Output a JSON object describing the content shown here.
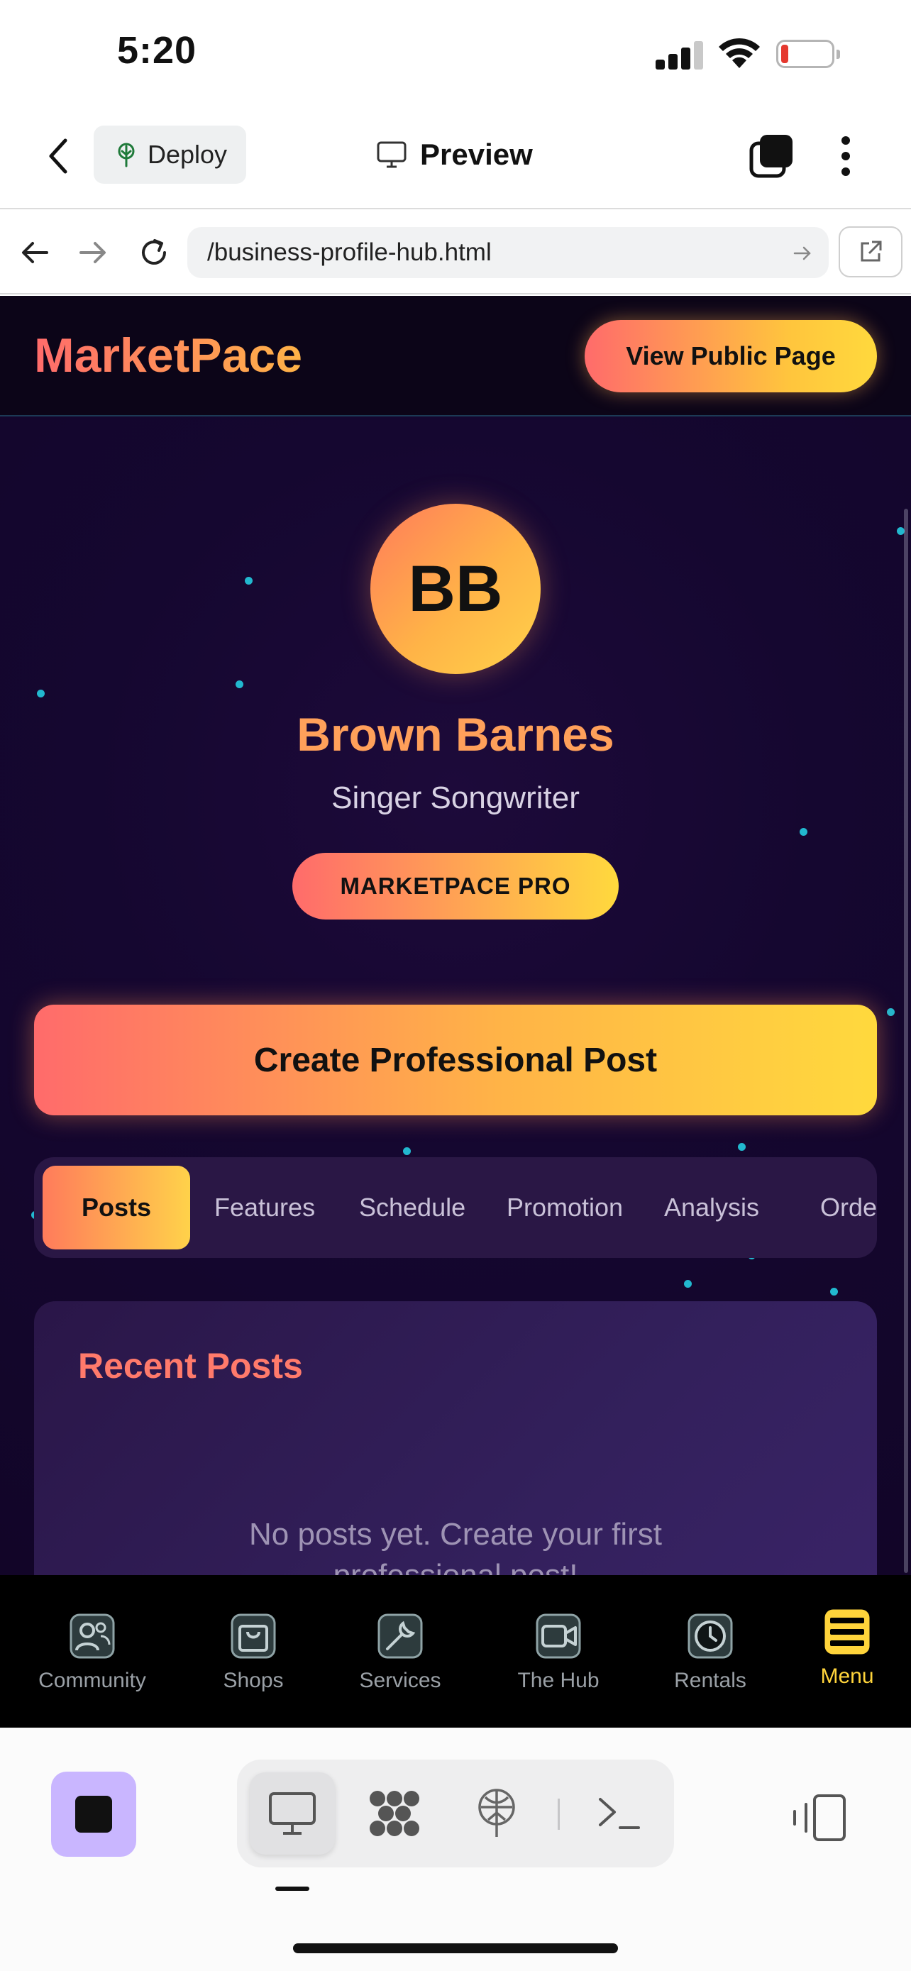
{
  "status_bar": {
    "time": "5:20",
    "signal_bars": 3,
    "battery_level": 0.1,
    "battery_color": "#e5392f"
  },
  "app_bar": {
    "deploy_label": "Deploy",
    "preview_label": "Preview"
  },
  "browser": {
    "url": "/business-profile-hub.html"
  },
  "site": {
    "brand": "MarketPace",
    "public_page_button": "View Public Page",
    "avatar_initials": "BB",
    "profile_name": "Brown Barnes",
    "profile_role": "Singer Songwriter",
    "badge": "MARKETPACE PRO",
    "create_post_button": "Create Professional Post",
    "tabs": [
      {
        "label": "Posts",
        "active": true
      },
      {
        "label": "Features",
        "active": false
      },
      {
        "label": "Schedule",
        "active": false
      },
      {
        "label": "Promotion",
        "active": false
      },
      {
        "label": "Analysis",
        "active": false
      },
      {
        "label": "Orde",
        "active": false
      }
    ],
    "recent_posts_title": "Recent Posts",
    "empty_message_line1": "No posts yet. Create your first",
    "empty_message_line2": "professional post!",
    "accent_gradient": [
      "#ff6b6b",
      "#ffd93d"
    ],
    "particle_color": "#22b8cf"
  },
  "bottom_nav": {
    "items": [
      {
        "label": "Community",
        "icon": "community-icon",
        "active": false
      },
      {
        "label": "Shops",
        "icon": "shopping-bag-icon",
        "active": false
      },
      {
        "label": "Services",
        "icon": "wrench-icon",
        "active": false
      },
      {
        "label": "The Hub",
        "icon": "video-camera-icon",
        "active": false
      },
      {
        "label": "Rentals",
        "icon": "clock-icon",
        "active": false
      },
      {
        "label": "Menu",
        "icon": "menu-icon",
        "active": true
      }
    ],
    "active_color": "#ffd43b"
  },
  "ide_toolbar": {
    "stop_color": "#c9b6ff",
    "segments": [
      {
        "icon": "desktop-preview-icon",
        "active": true
      },
      {
        "icon": "agent-icon",
        "active": false
      },
      {
        "icon": "deploy-icon",
        "active": false
      },
      {
        "icon": "terminal-icon",
        "active": false
      }
    ]
  }
}
